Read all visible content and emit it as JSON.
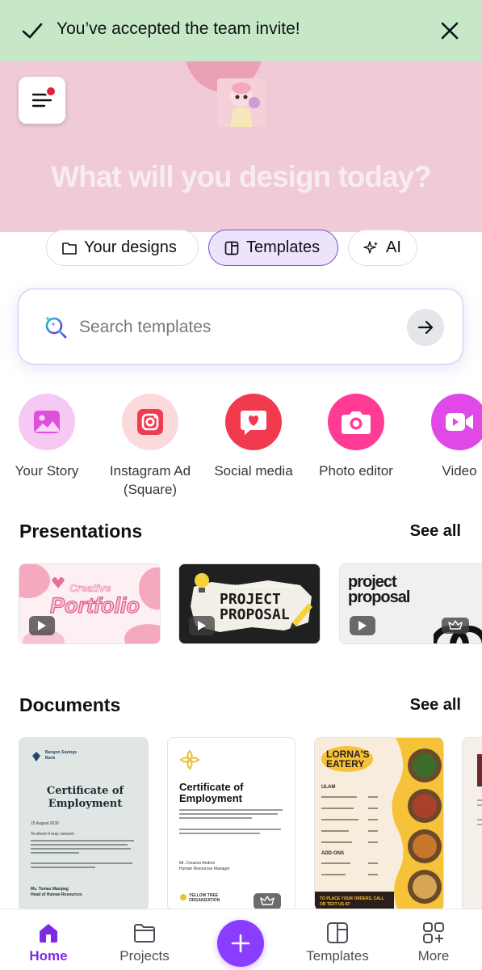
{
  "toast": {
    "message": "You’ve accepted the team invite!"
  },
  "hero": {
    "title": "What will you design today?"
  },
  "tabs": [
    {
      "label": "Your designs",
      "icon": "folder-icon"
    },
    {
      "label": "Templates",
      "icon": "template-icon",
      "active": true
    },
    {
      "label": "AI",
      "icon": "sparkle-icon"
    }
  ],
  "search": {
    "placeholder": "Search templates"
  },
  "categories": [
    {
      "label": "Your Story",
      "icon": "image-icon"
    },
    {
      "label": "Instagram Ad (Square)",
      "icon": "instagram-icon"
    },
    {
      "label": "Social media",
      "icon": "heart-chat-icon"
    },
    {
      "label": "Photo editor",
      "icon": "camera-icon"
    },
    {
      "label": "Video",
      "icon": "video-icon"
    }
  ],
  "presentations": {
    "title": "Presentations",
    "see_all": "See all",
    "cards": [
      {
        "line1": "Creative",
        "line2": "Portfolio"
      },
      {
        "line1": "CREATIVE MARKETING AGENCY",
        "line2": "PROJECT",
        "line3": "PROPOSAL"
      },
      {
        "line1": "project",
        "line2": "proposal"
      }
    ]
  },
  "documents": {
    "title": "Documents",
    "see_all": "See all",
    "cards": [
      {
        "org": "Bangon Savings Bank",
        "heading": "Certificate of Employment",
        "date": "15 August 2030",
        "greeting": "To whom it may concern",
        "signer": "Ms. Tomas Masipag",
        "signer_title": "Head of Human Resources"
      },
      {
        "heading": "Certificate of Employment",
        "signer": "Mr. Corazon Andres",
        "signer_title": "Human Resources Manager",
        "org": "YELLOW TREE ORGANIZATION"
      },
      {
        "title_line1": "LORNA'S",
        "title_line2": "EATERY",
        "section1": "ULAM",
        "section2": "ADD-ONS",
        "footer": "TO PLACE YOUR ORDERS, CALL OR TEXT US AT"
      }
    ]
  },
  "nav": {
    "items": [
      {
        "label": "Home",
        "icon": "home-icon",
        "active": true
      },
      {
        "label": "Projects",
        "icon": "folder-icon"
      },
      {
        "label": "Templates",
        "icon": "template-icon"
      },
      {
        "label": "More",
        "icon": "more-grid-icon"
      }
    ],
    "fab_icon": "plus-icon"
  },
  "colors": {
    "accent": "#8b3dff",
    "toast_bg": "#c7e8c6",
    "hero_bg": "#f0cad6"
  }
}
